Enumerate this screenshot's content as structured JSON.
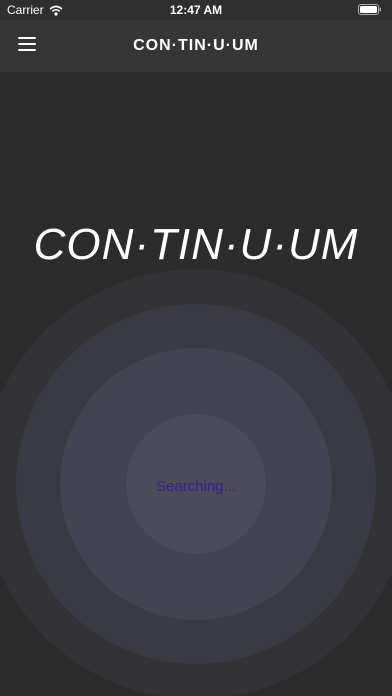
{
  "status_bar": {
    "carrier": "Carrier",
    "time": "12:47 AM",
    "wifi_icon": "wifi-icon",
    "battery_icon": "battery-icon"
  },
  "nav": {
    "title": "CON·TIN·U·UM",
    "menu_icon": "hamburger-menu-icon"
  },
  "main": {
    "logo_text": "CON·TIN·U·UM",
    "status_text": "Searching...",
    "status_color": "#3a1f8f"
  }
}
